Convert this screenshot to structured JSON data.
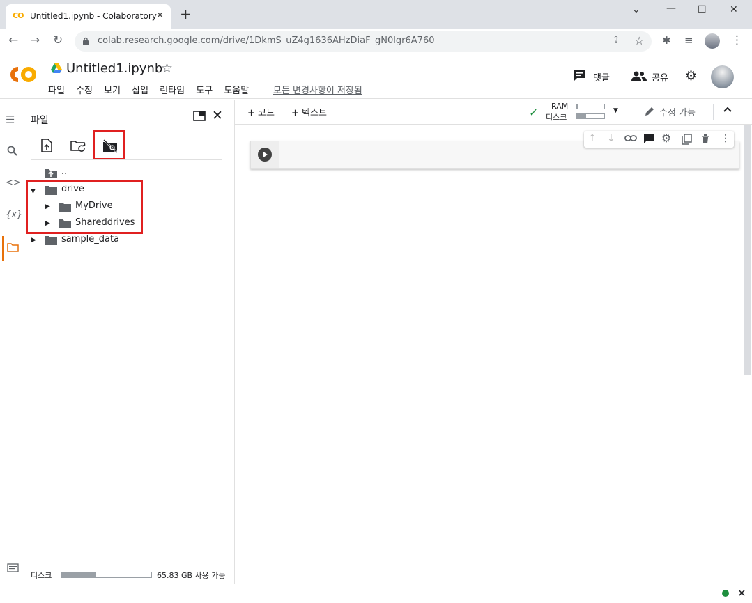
{
  "browser": {
    "tab_title": "Untitled1.ipynb - Colaboratory",
    "favicon_text": "CO",
    "url": "colab.research.google.com/drive/1DkmS_uZ4g1636AHzDiaF_gN0lgr6A760"
  },
  "header": {
    "logo": "CO",
    "notebook_title": "Untitled1.ipynb",
    "menu": [
      "파일",
      "수정",
      "보기",
      "삽입",
      "런타임",
      "도구",
      "도움말"
    ],
    "save_status": "모든 변경사항이 저장됨",
    "comment_label": "댓글",
    "share_label": "공유"
  },
  "panel": {
    "title": "파일",
    "tree": {
      "parent": "..",
      "drive": "drive",
      "mydrive": "MyDrive",
      "shareddrives": "Shareddrives",
      "sample_data": "sample_data"
    },
    "disk_label": "디스크",
    "disk_available": "65.83 GB 사용 가능",
    "disk_used_fraction": 0.38
  },
  "main": {
    "add_code": "+ 코드",
    "add_text": "+ 텍스트",
    "ram_label": "RAM",
    "disk_label": "디스크",
    "edit_mode": "수정 가능"
  },
  "colors": {
    "accent_orange": "#f9ab00",
    "highlight_red": "#e02020",
    "status_green": "#1e8e3e"
  }
}
